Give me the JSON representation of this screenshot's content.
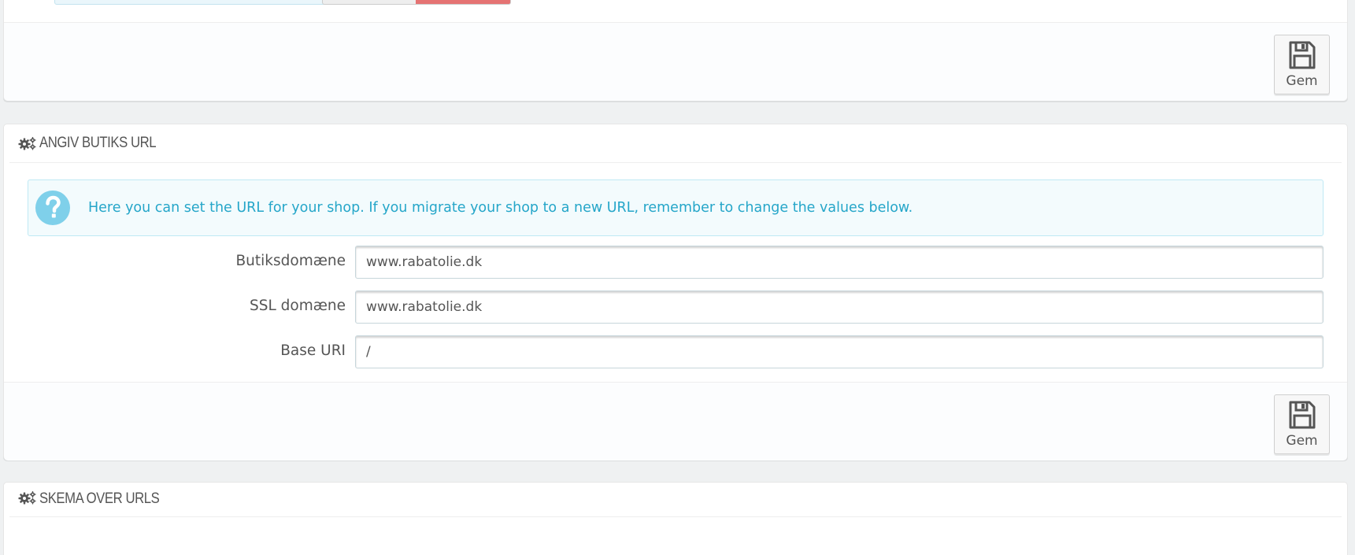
{
  "panel_top": {
    "save_label": "Gem"
  },
  "shop_url": {
    "title": "ANGIV BUTIKS URL",
    "info_message": "Here you can set the URL for your shop. If you migrate your shop to a new URL, remember to change the values below.",
    "fields": [
      {
        "label": "Butiksdomæne",
        "value": "www.rabatolie.dk"
      },
      {
        "label": "SSL domæne",
        "value": "www.rabatolie.dk"
      },
      {
        "label": "Base URI",
        "value": "/"
      }
    ],
    "save_label": "Gem"
  },
  "schema": {
    "title": "SKEMA OVER URLS"
  },
  "icons": {
    "heading": "cogs-icon",
    "info": "question-circle-icon",
    "save": "floppy-disk-icon"
  },
  "colors": {
    "info_text": "#25a6c9",
    "info_icon": "#7fd0ea",
    "toggle_on": "#e57373"
  }
}
